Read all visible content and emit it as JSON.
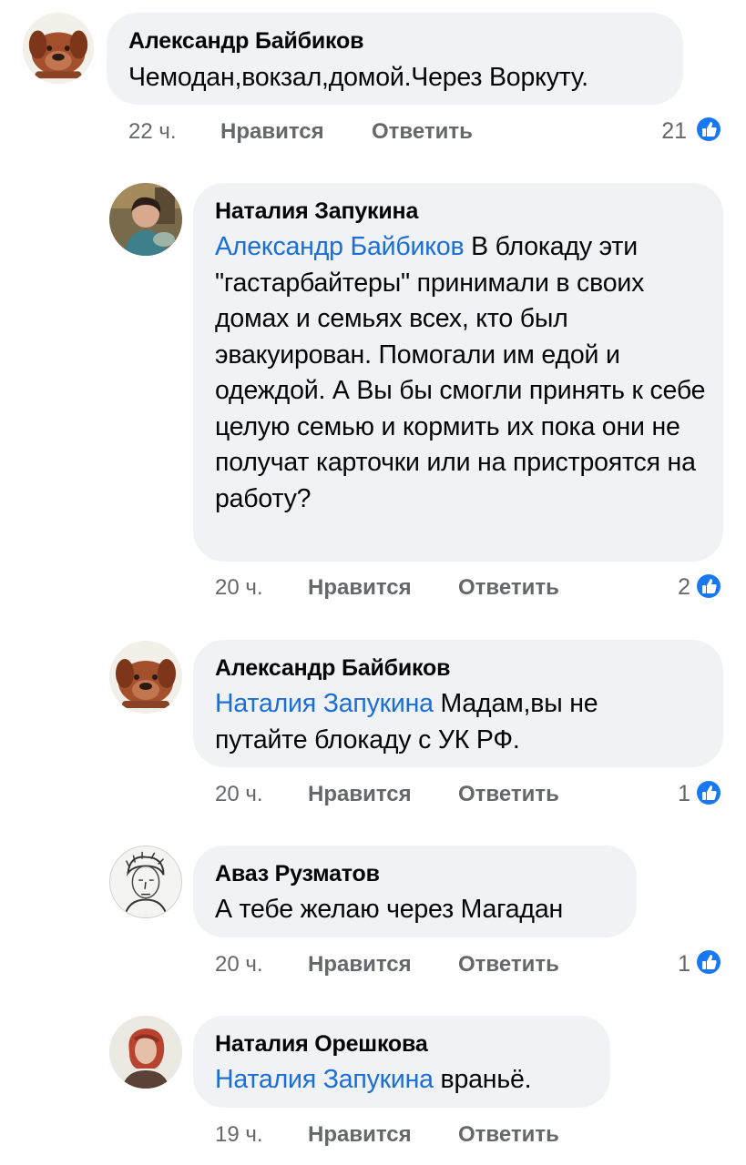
{
  "comments": [
    {
      "author": "Александр Байбиков",
      "mention": "",
      "text": "Чемодан,вокзал,домой.Через Воркуту.",
      "time": "22 ч.",
      "like_label": "Нравится",
      "reply_label": "Ответить",
      "reactions": "21",
      "avatar_icon": "bulldog-avatar"
    },
    {
      "author": "Наталия Запукина",
      "mention": "Александр Байбиков",
      "text": "В блокаду эти \"гастарбайтеры\" принимали в своих домах и семьях всех, кто был эвакуирован. Помогали им едой и одеждой. А Вы бы смогли принять к себе целую семью и кормить их  пока они не получат карточки или на пристроятся на работу?",
      "time": "20 ч.",
      "like_label": "Нравится",
      "reply_label": "Ответить",
      "reactions": "2",
      "avatar_icon": "woman-photo-avatar"
    },
    {
      "author": "Александр Байбиков",
      "mention": "Наталия Запукина",
      "text": "Мадам,вы не путайте блокаду с УК РФ.",
      "time": "20 ч.",
      "like_label": "Нравится",
      "reply_label": "Ответить",
      "reactions": "1",
      "avatar_icon": "bulldog-avatar"
    },
    {
      "author": "Аваз Рузматов",
      "mention": "",
      "text": "А тебе желаю через Магадан",
      "time": "20 ч.",
      "like_label": "Нравится",
      "reply_label": "Ответить",
      "reactions": "1",
      "avatar_icon": "sketch-portrait-avatar"
    },
    {
      "author": "Наталия Орешкова",
      "mention": "Наталия Запукина",
      "text": "враньё.",
      "time": "19 ч.",
      "like_label": "Нравится",
      "reply_label": "Ответить",
      "reactions": "",
      "avatar_icon": "woman-portrait-avatar"
    }
  ],
  "colors": {
    "mention": "#1a6ed8",
    "like_badge": "#1877f2",
    "bubble": "#f0f2f5",
    "meta": "#65676b"
  }
}
